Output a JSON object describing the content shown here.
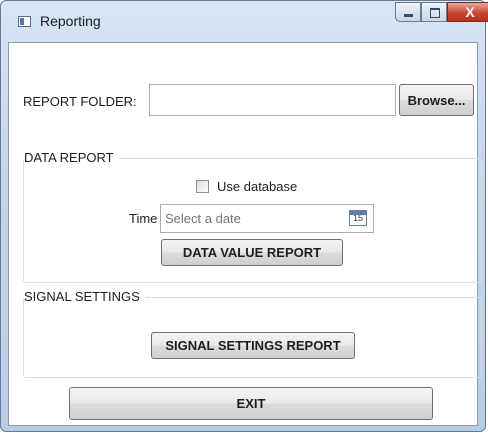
{
  "window": {
    "title": "Reporting",
    "close_glyph": "X"
  },
  "report_folder": {
    "label": "REPORT FOLDER:",
    "value": "",
    "browse_label": "Browse..."
  },
  "data_report": {
    "header": "DATA REPORT",
    "use_database_label": "Use database",
    "use_database_checked": false,
    "time_label": "Time",
    "date_placeholder": "Select a date",
    "calendar_day": "15",
    "data_value_button": "DATA VALUE REPORT"
  },
  "signal_settings": {
    "header": "SIGNAL SETTINGS",
    "report_button": "SIGNAL SETTINGS REPORT"
  },
  "footer": {
    "exit_label": "EXIT"
  },
  "icons": [
    "window-app-icon",
    "minimize-icon",
    "maximize-icon",
    "close-icon",
    "calendar-icon"
  ]
}
